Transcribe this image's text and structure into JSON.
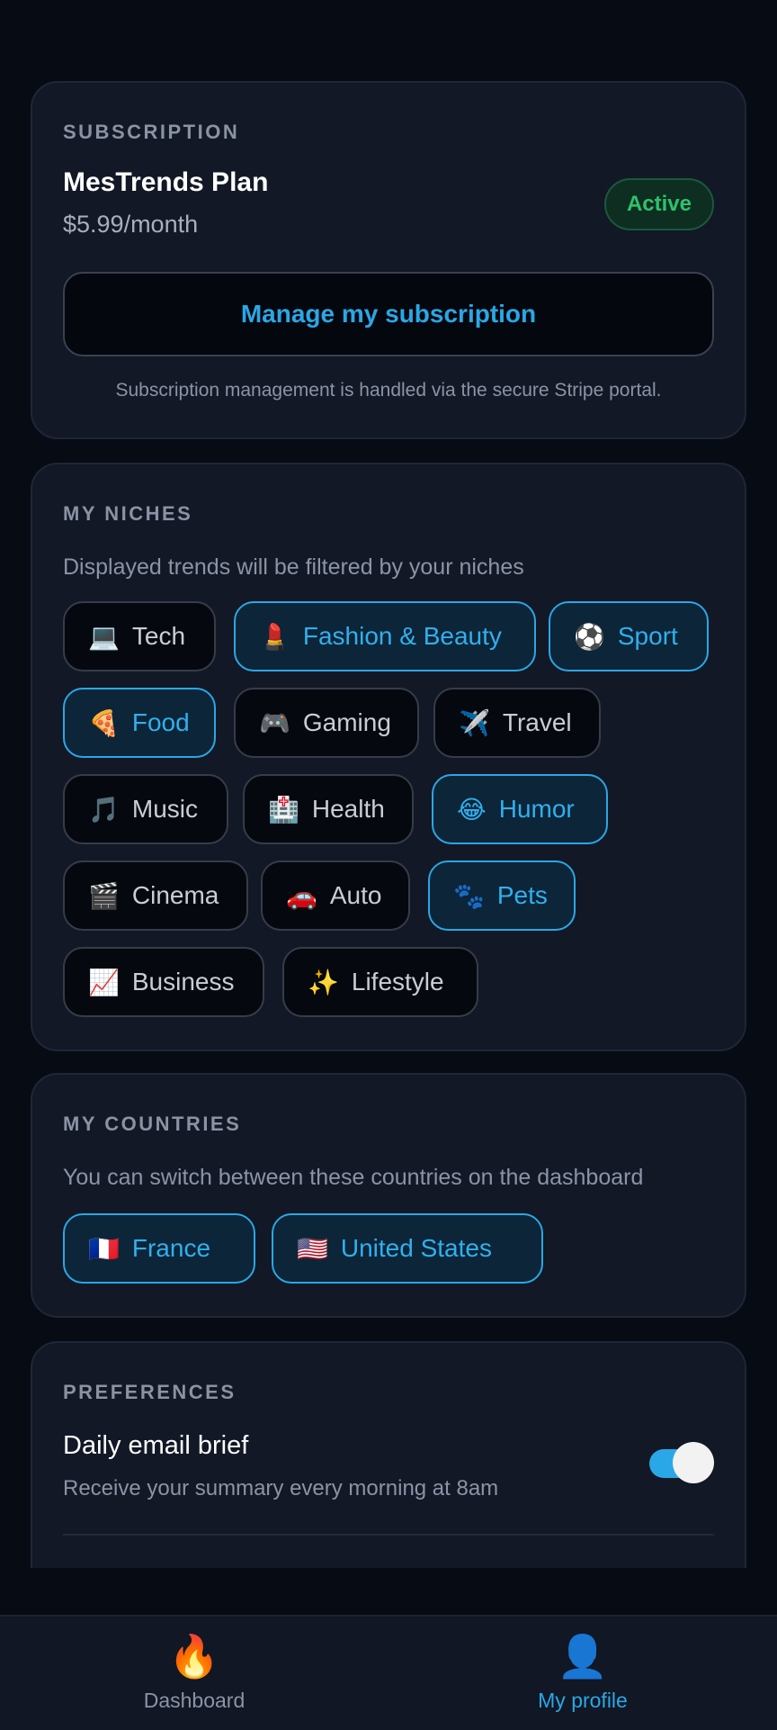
{
  "subscription": {
    "section_title": "SUBSCRIPTION",
    "plan_name": "MesTrends Plan",
    "price": "$5.99/month",
    "status": "Active",
    "manage_button": "Manage my subscription",
    "note": "Subscription management is handled via the secure Stripe portal."
  },
  "niches": {
    "section_title": "MY NICHES",
    "description": "Displayed trends will be filtered by your niches",
    "items": [
      {
        "emoji": "💻",
        "label": "Tech",
        "selected": false
      },
      {
        "emoji": "💄",
        "label": "Fashion & Beauty",
        "selected": true
      },
      {
        "emoji": "⚽",
        "label": "Sport",
        "selected": true
      },
      {
        "emoji": "🍕",
        "label": "Food",
        "selected": true
      },
      {
        "emoji": "🎮",
        "label": "Gaming",
        "selected": false
      },
      {
        "emoji": "✈️",
        "label": "Travel",
        "selected": false
      },
      {
        "emoji": "🎵",
        "label": "Music",
        "selected": false
      },
      {
        "emoji": "🏥",
        "label": "Health",
        "selected": false
      },
      {
        "emoji": "😂",
        "label": "Humor",
        "selected": true
      },
      {
        "emoji": "🎬",
        "label": "Cinema",
        "selected": false
      },
      {
        "emoji": "🚗",
        "label": "Auto",
        "selected": false
      },
      {
        "emoji": "🐾",
        "label": "Pets",
        "selected": true
      },
      {
        "emoji": "📈",
        "label": "Business",
        "selected": false
      },
      {
        "emoji": "✨",
        "label": "Lifestyle",
        "selected": false
      }
    ]
  },
  "countries": {
    "section_title": "MY COUNTRIES",
    "description": "You can switch between these countries on the dashboard",
    "items": [
      {
        "emoji": "🇫🇷",
        "label": "France",
        "selected": true
      },
      {
        "emoji": "🇺🇸",
        "label": "United States",
        "selected": true
      }
    ]
  },
  "preferences": {
    "section_title": "PREFERENCES",
    "daily_email_title": "Daily email brief",
    "daily_email_sub": "Receive your summary every morning at 8am",
    "daily_email_enabled": true
  },
  "bottom_nav": {
    "items": [
      {
        "icon": "🔥",
        "label": "Dashboard",
        "active": false
      },
      {
        "icon": "👤",
        "label": "My profile",
        "active": true
      }
    ]
  },
  "colors": {
    "accent": "#2aa7e6",
    "active_badge": "#2fc26a",
    "background": "#060b14",
    "card": "#121826"
  }
}
